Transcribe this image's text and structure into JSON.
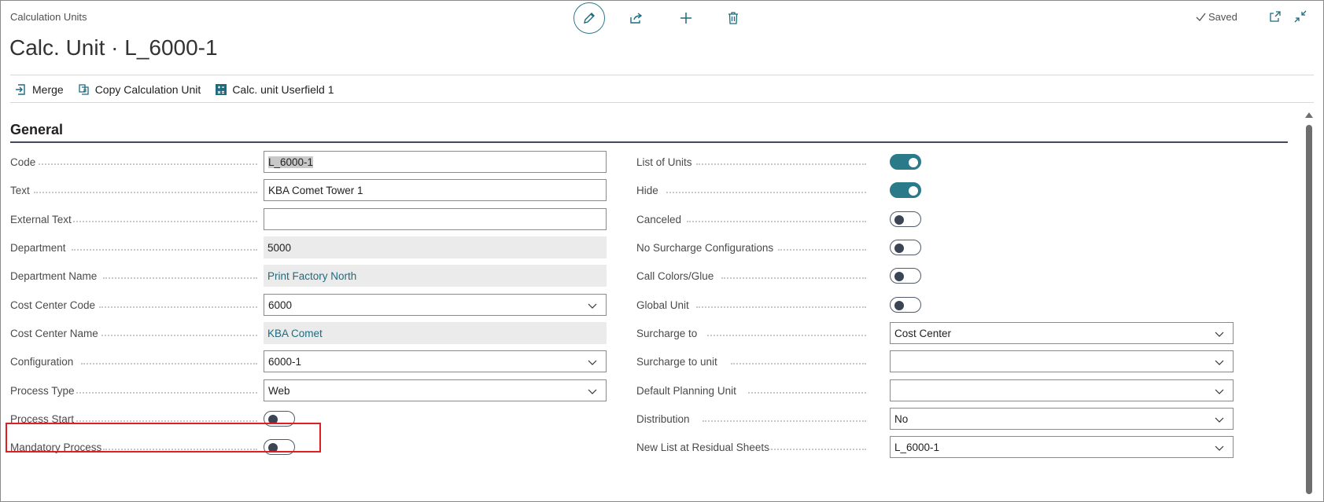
{
  "header": {
    "breadcrumb": "Calculation Units",
    "title": "Calc. Unit · L_6000-1",
    "saved_label": "Saved"
  },
  "toolbar": {
    "merge": "Merge",
    "copy": "Copy Calculation Unit",
    "userfield": "Calc. unit Userfield 1"
  },
  "section": {
    "title": "General"
  },
  "left_fields": {
    "code": {
      "label": "Code",
      "value": "L_6000-1"
    },
    "text": {
      "label": "Text",
      "value": "KBA Comet Tower 1"
    },
    "external_text": {
      "label": "External Text",
      "value": ""
    },
    "department": {
      "label": "Department",
      "value": "5000"
    },
    "department_name": {
      "label": "Department Name",
      "value": "Print Factory North"
    },
    "cost_center_code": {
      "label": "Cost Center Code",
      "value": "6000"
    },
    "cost_center_name": {
      "label": "Cost Center Name",
      "value": "KBA Comet"
    },
    "configuration": {
      "label": "Configuration",
      "value": "6000-1"
    },
    "process_type": {
      "label": "Process Type",
      "value": "Web"
    },
    "process_start": {
      "label": "Process Start",
      "on": false
    },
    "mandatory_process": {
      "label": "Mandatory Process",
      "on": false
    }
  },
  "right_fields": {
    "list_of_units": {
      "label": "List of Units",
      "on": true
    },
    "hide": {
      "label": "Hide",
      "on": true
    },
    "canceled": {
      "label": "Canceled",
      "on": false
    },
    "no_surcharge": {
      "label": "No Surcharge Configurations",
      "on": false
    },
    "call_colors": {
      "label": "Call Colors/Glue",
      "on": false
    },
    "global_unit": {
      "label": "Global Unit",
      "on": false
    },
    "surcharge_to": {
      "label": "Surcharge to",
      "value": "Cost Center"
    },
    "surcharge_to_unit": {
      "label": "Surcharge to unit",
      "value": ""
    },
    "default_planning_unit": {
      "label": "Default Planning Unit",
      "value": ""
    },
    "distribution": {
      "label": "Distribution",
      "value": "No"
    },
    "new_list_residual": {
      "label": "New List at Residual Sheets",
      "value": "L_6000-1"
    }
  },
  "colors": {
    "accent": "#2a7a8a",
    "highlight": "#e02020"
  }
}
